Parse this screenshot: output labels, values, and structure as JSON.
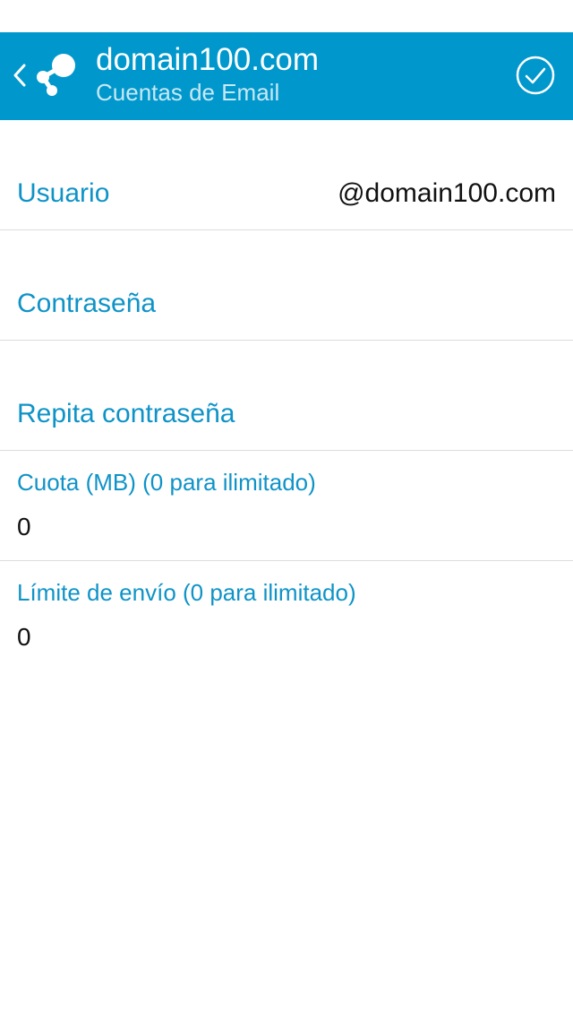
{
  "header": {
    "title": "domain100.com",
    "subtitle": "Cuentas de Email",
    "back_icon": "chevron-left-icon",
    "logo_icon": "share-logo-icon",
    "confirm_icon": "check-circle-icon",
    "background_color": "#0098cc"
  },
  "form": {
    "user": {
      "label": "Usuario",
      "value": "@domain100.com"
    },
    "password": {
      "label": "Contraseña",
      "value": ""
    },
    "repeat_password": {
      "label": "Repita contraseña",
      "value": ""
    },
    "quota": {
      "label": "Cuota (MB) (0 para ilimitado)",
      "value": "0"
    },
    "send_limit": {
      "label": "Límite de envío (0 para ilimitado)",
      "value": "0"
    },
    "label_color": "#0f93c7"
  }
}
